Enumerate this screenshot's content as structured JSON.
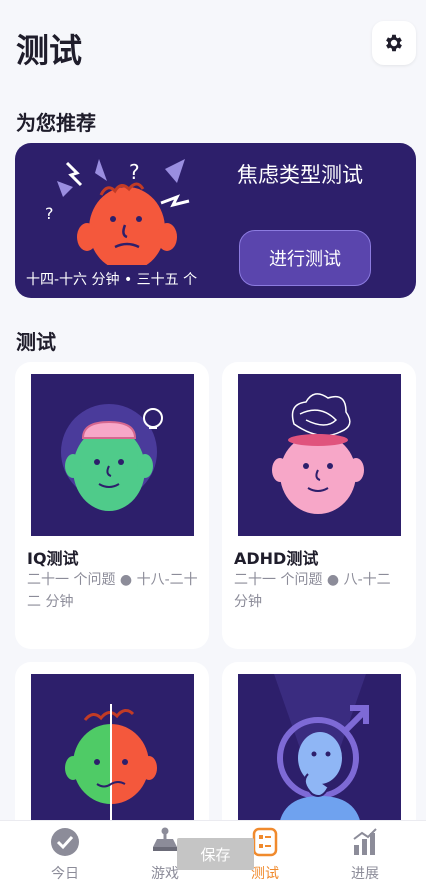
{
  "header": {
    "title": "测试",
    "settings_icon": "gear-icon"
  },
  "recommended": {
    "section_title": "为您推荐",
    "title": "焦虑类型测试",
    "button_label": "进行测试",
    "meta": "十四-十六 分钟 • 三十五 个",
    "background_color": "#2d1f6b"
  },
  "tests": {
    "section_title": "测试",
    "cards": [
      {
        "title": "IQ测试",
        "meta": "二十一 个问题 ● 十八-二十二 分钟",
        "art": "brain-head-illustration"
      },
      {
        "title": "ADHD测试",
        "meta": "二十一 个问题 ● 八-十二 分钟",
        "art": "tangled-thoughts-head-illustration"
      },
      {
        "title": "",
        "meta": "",
        "art": "split-face-illustration"
      },
      {
        "title": "",
        "meta": "",
        "art": "gender-thinking-person-illustration"
      }
    ]
  },
  "nav": {
    "items": [
      {
        "label": "今日",
        "icon": "check-circle-icon",
        "active": false
      },
      {
        "label": "游戏",
        "icon": "joystick-icon",
        "active": false
      },
      {
        "label": "测试",
        "icon": "checklist-icon",
        "active": true
      },
      {
        "label": "进展",
        "icon": "bar-chart-icon",
        "active": false
      }
    ],
    "active_color": "#f08a2d"
  },
  "toast": {
    "label": "保存"
  }
}
